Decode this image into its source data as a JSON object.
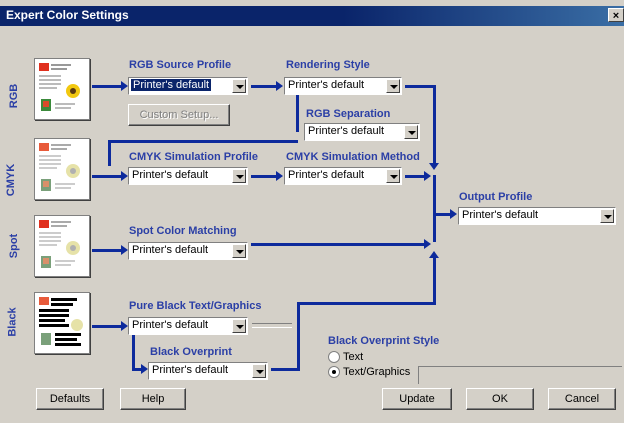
{
  "window": {
    "title": "Expert Color Settings",
    "close_glyph": "×"
  },
  "rows": {
    "rgb": "RGB",
    "cmyk": "CMYK",
    "spot": "Spot",
    "black": "Black"
  },
  "rgb_source": {
    "label": "RGB Source Profile",
    "value": "Printer's default"
  },
  "rendering": {
    "label": "Rendering Style",
    "value": "Printer's default"
  },
  "custom_setup": {
    "label": "Custom Setup..."
  },
  "rgb_sep": {
    "label": "RGB Separation",
    "value": "Printer's default"
  },
  "cmyk_sim_profile": {
    "label": "CMYK Simulation Profile",
    "value": "Printer's default"
  },
  "cmyk_sim_method": {
    "label": "CMYK Simulation Method",
    "value": "Printer's default"
  },
  "output_profile": {
    "label": "Output Profile",
    "value": "Printer's default"
  },
  "spot_matching": {
    "label": "Spot Color Matching",
    "value": "Printer's default"
  },
  "pure_black": {
    "label": "Pure Black Text/Graphics",
    "value": "Printer's default"
  },
  "black_overprint": {
    "label": "Black Overprint",
    "value": "Printer's default"
  },
  "overprint_style": {
    "label": "Black Overprint Style",
    "options": [
      "Text",
      "Text/Graphics"
    ],
    "selected": "Text/Graphics"
  },
  "buttons": {
    "defaults": "Defaults",
    "help": "Help",
    "update": "Update",
    "ok": "OK",
    "cancel": "Cancel"
  },
  "colors": {
    "accent": "#0d2a9c",
    "title_bar": "#0a246a",
    "label": "#2b3fa6"
  }
}
